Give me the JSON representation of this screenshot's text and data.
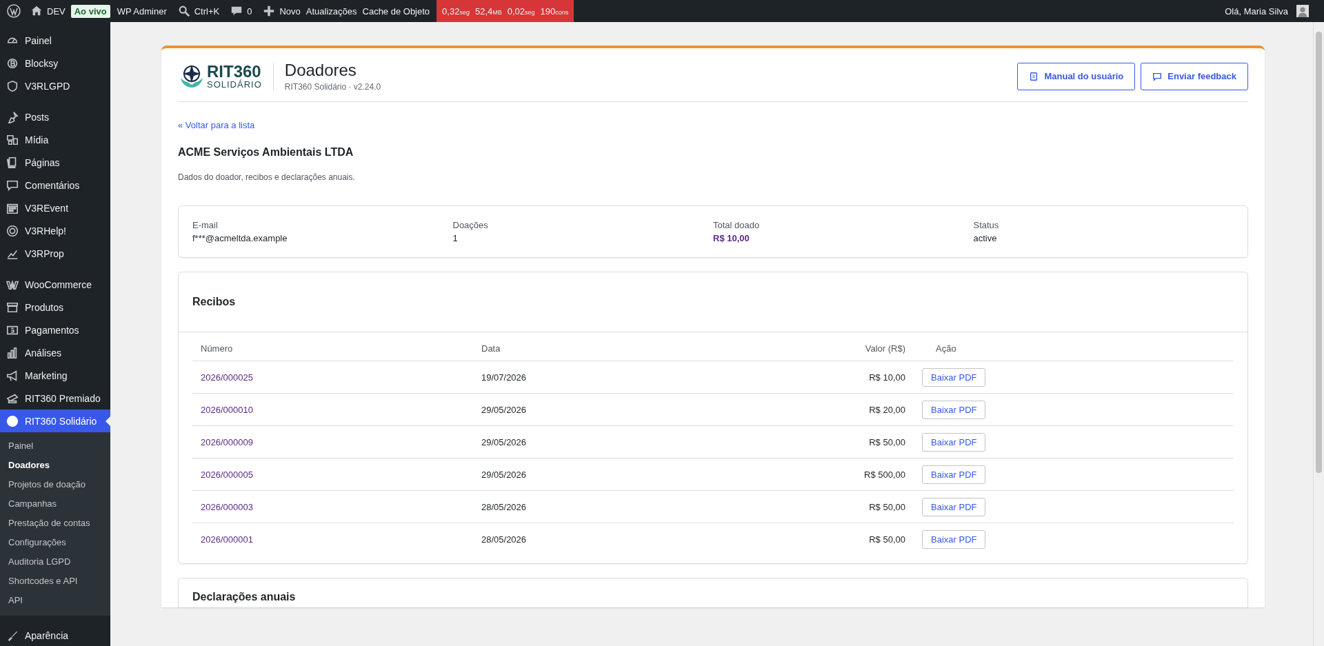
{
  "admin_bar": {
    "site": "DEV",
    "env_badge": "Ao vivo",
    "adminer": "WP Adminer",
    "search_shortcut": "Ctrl+K",
    "comments": "0",
    "new": "Novo",
    "updates": "Atualizações",
    "cache": "Cache de Objeto",
    "perf": [
      {
        "value": "0,32",
        "unit": "seg"
      },
      {
        "value": "52,4",
        "unit": "MB"
      },
      {
        "value": "0,02",
        "unit": "seg"
      },
      {
        "value": "190",
        "unit": "cons"
      }
    ],
    "greeting": "Olá, Maria Silva"
  },
  "sidebar": {
    "groups": [
      [
        {
          "label": "Painel",
          "selected": false
        },
        {
          "label": "Blocksy",
          "selected": false
        },
        {
          "label": "V3RLGPD",
          "selected": false
        }
      ],
      [
        {
          "label": "Posts",
          "selected": false
        },
        {
          "label": "Mídia",
          "selected": false
        },
        {
          "label": "Páginas",
          "selected": false
        },
        {
          "label": "Comentários",
          "selected": false
        },
        {
          "label": "V3REvent",
          "selected": false
        },
        {
          "label": "V3RHelp!",
          "selected": false
        },
        {
          "label": "V3RProp",
          "selected": false
        }
      ],
      [
        {
          "label": "WooCommerce",
          "selected": false
        },
        {
          "label": "Produtos",
          "selected": false
        },
        {
          "label": "Pagamentos",
          "selected": false
        },
        {
          "label": "Análises",
          "selected": false
        },
        {
          "label": "Marketing",
          "selected": false
        },
        {
          "label": "RIT360 Premiado",
          "selected": false
        },
        {
          "label": "RIT360 Solidário",
          "selected": true
        }
      ]
    ],
    "submenu": [
      {
        "label": "Painel",
        "selected": false
      },
      {
        "label": "Doadores",
        "selected": true
      },
      {
        "label": "Projetos de doação",
        "selected": false
      },
      {
        "label": "Campanhas",
        "selected": false
      },
      {
        "label": "Prestação de contas",
        "selected": false
      },
      {
        "label": "Configurações",
        "selected": false
      },
      {
        "label": "Auditoria LGPD",
        "selected": false
      },
      {
        "label": "Shortcodes e API",
        "selected": false
      },
      {
        "label": "API",
        "selected": false
      }
    ],
    "after": [
      {
        "label": "Aparência",
        "selected": false
      }
    ]
  },
  "header": {
    "logo_main": "RIT360",
    "logo_sub": "SOLIDÁRIO",
    "title": "Doadores",
    "subtitle": "RIT360 Solidário · v2.24.0",
    "buttons": [
      {
        "label": "Manual do usuário",
        "kind": "manual"
      },
      {
        "label": "Enviar feedback",
        "kind": "feedback"
      }
    ]
  },
  "back_link": "« Voltar para a lista",
  "donor_name": "ACME Serviços Ambientais LTDA",
  "description": "Dados do doador, recibos e declarações anuais.",
  "summary": [
    {
      "label": "E-mail",
      "value": "f***@acmeltda.example",
      "kind": "text"
    },
    {
      "label": "Doações",
      "value": "1",
      "kind": "text"
    },
    {
      "label": "Total doado",
      "value": "R$ 10,00",
      "kind": "money"
    },
    {
      "label": "Status",
      "value": "active",
      "kind": "text"
    }
  ],
  "receipts": {
    "title": "Recibos",
    "columns": [
      "Número",
      "Data",
      "Valor (R$)",
      "Ação"
    ],
    "rows": [
      {
        "number": "2026/000025",
        "date": "19/07/2026",
        "value": "R$ 10,00",
        "action": "Baixar PDF"
      },
      {
        "number": "2026/000010",
        "date": "29/05/2026",
        "value": "R$ 20,00",
        "action": "Baixar PDF"
      },
      {
        "number": "2026/000009",
        "date": "29/05/2026",
        "value": "R$ 50,00",
        "action": "Baixar PDF"
      },
      {
        "number": "2026/000005",
        "date": "29/05/2026",
        "value": "R$ 500,00",
        "action": "Baixar PDF"
      },
      {
        "number": "2026/000003",
        "date": "28/05/2026",
        "value": "R$ 50,00",
        "action": "Baixar PDF"
      },
      {
        "number": "2026/000001",
        "date": "28/05/2026",
        "value": "R$ 50,00",
        "action": "Baixar PDF"
      }
    ]
  },
  "declarations": {
    "title": "Declarações anuais"
  }
}
